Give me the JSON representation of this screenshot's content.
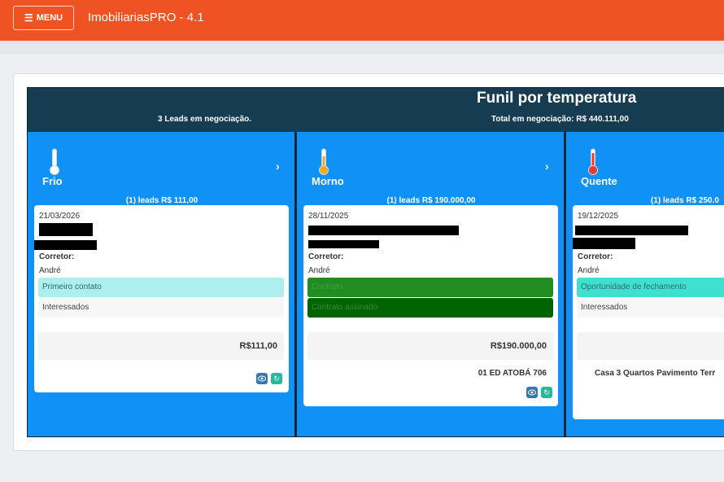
{
  "topbar": {
    "menu_label": "MENU",
    "app_title": "ImobiliariasPRO - 4.1"
  },
  "funnel": {
    "title": "Funil por temperatura",
    "leads_text": "3 Leads em negociação.",
    "total_text": "Total em negociação: R$ 440.111,00"
  },
  "columns": [
    {
      "name": "Frio",
      "summary": "(1) leads R$ 111,00",
      "arrow": "›",
      "thermo_color": "#ffffff",
      "card": {
        "date": "21/03/2026",
        "broker_label": "Corretor:",
        "broker_name": "André",
        "stage": "Primeiro contato",
        "status": "Interessados",
        "price": "R$111,00",
        "property": ""
      }
    },
    {
      "name": "Morno",
      "summary": "(1) leads R$ 190.000,00",
      "arrow": "›",
      "thermo_color": "#f5a623",
      "card": {
        "date": "28/11/2025",
        "broker_label": "Corretor:",
        "broker_name": "André",
        "stage": "Contrato",
        "status": "Contrato assinado",
        "price": "R$190.000,00",
        "property": "01 ED ATOBÁ 706"
      }
    },
    {
      "name": "Quente",
      "summary": "(1) leads R$ 250.0",
      "arrow": "",
      "thermo_color": "#e53935",
      "card": {
        "date": "19/12/2025",
        "broker_label": "Corretor:",
        "broker_name": "André",
        "stage": "Oportunidade de fechamento",
        "status": "Interessados",
        "price": "",
        "property": "Casa 3 Quartos Pavimento Terr"
      }
    }
  ],
  "colors": {
    "topbar": "#f05323",
    "column": "#1091f5",
    "header": "#163c52",
    "stage_frio": "#aeeef0",
    "stage_morno": "#228b22",
    "status_morno": "#006400",
    "stage_quente": "#40e0d0"
  },
  "icons": {
    "menu": "menu-bars-icon",
    "thermometer": "thermometer-icon",
    "view": "eye-icon",
    "refresh": "refresh-icon"
  }
}
